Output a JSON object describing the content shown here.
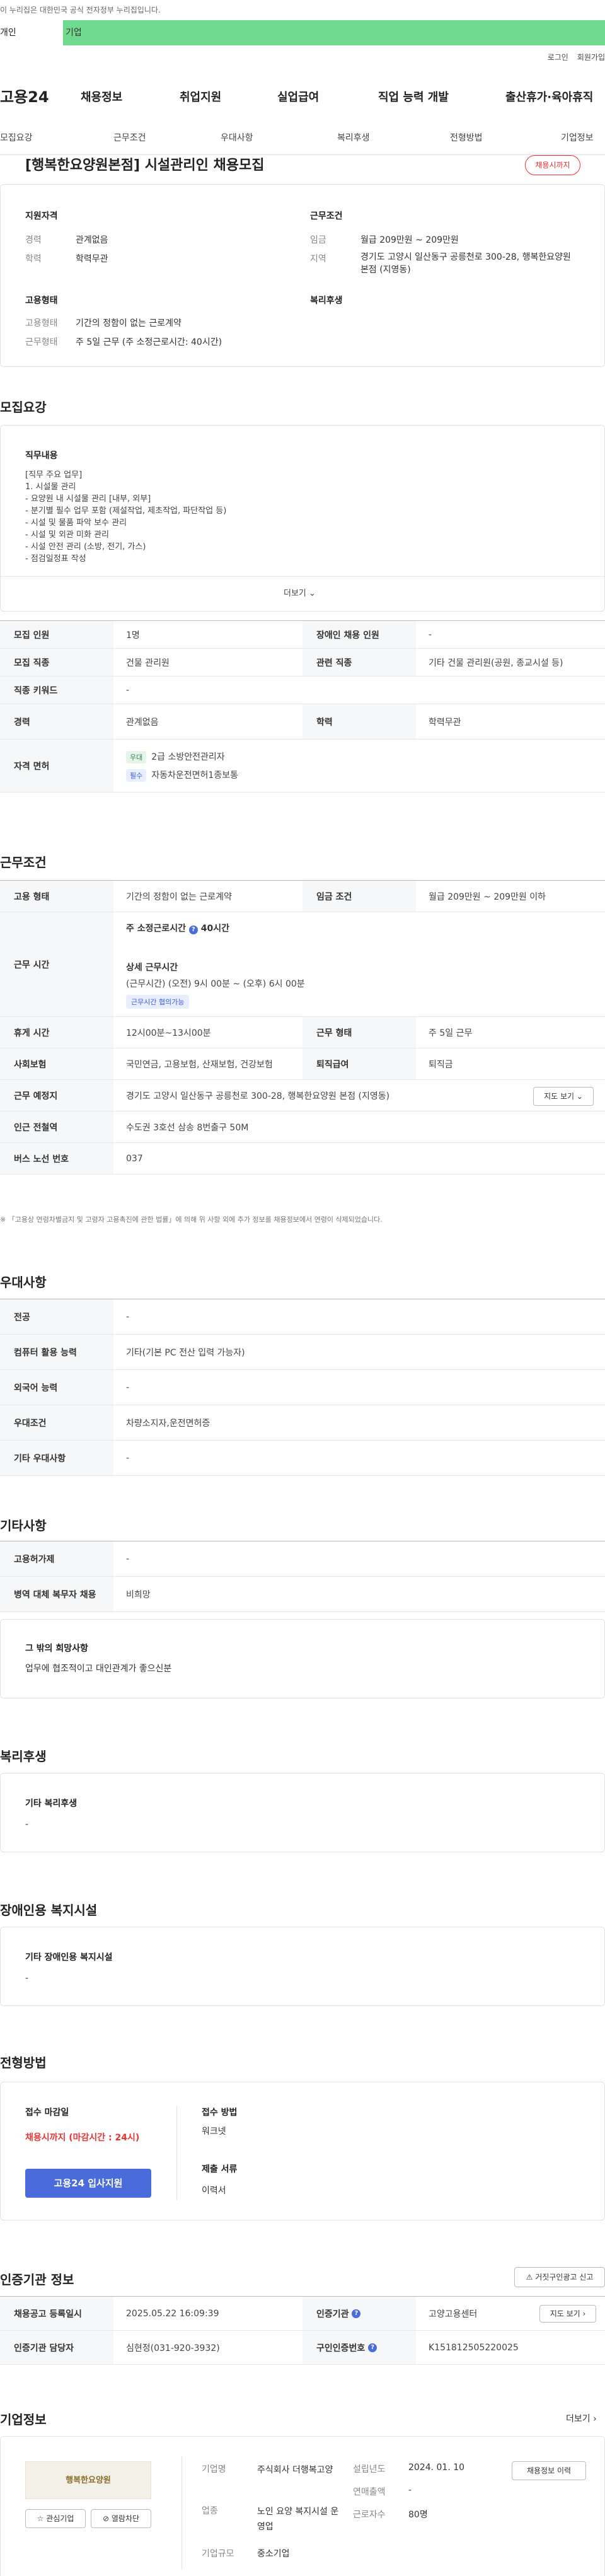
{
  "notice": "이 누리집은 대한민국 공식 전자정부 누리집입니다.",
  "tabs": {
    "personal": "개인",
    "company": "기업"
  },
  "util": {
    "login": "로그인",
    "join": "회원가입"
  },
  "logo": "고용24",
  "gnb": [
    "채용정보",
    "취업지원",
    "실업급여",
    "직업 능력 개발",
    "출산휴가·육아휴직"
  ],
  "lnb": [
    "모집요강",
    "근무조건",
    "우대사항",
    "복리후생",
    "전형방법",
    "기업정보"
  ],
  "job": {
    "title": "[행복한요양원본점] 시설관리인 채용모집",
    "status": "채용시까지"
  },
  "summary": {
    "qual_title": "지원자격",
    "career_label": "경력",
    "career": "관계없음",
    "edu_label": "학력",
    "edu": "학력무관",
    "cond_title": "근무조건",
    "wage_label": "임금",
    "wage": "월급 209만원 ~ 209만원",
    "region_label": "지역",
    "region": "경기도 고양시 일산동구 공릉천로 300-28, 행복한요양원 본점 (지영동)",
    "emp_title": "고용형태",
    "emptype_label": "고용형태",
    "emptype": "기간의 정함이 없는 근로계약",
    "worktype_label": "근무형태",
    "worktype": "주 5일 근무 (주 소정근로시간: 40시간)",
    "welfare_title": "복리후생"
  },
  "recruit": {
    "title": "모집요강",
    "duty_title": "직무내용",
    "duty_lines": [
      "[직무 주요 업무]",
      "1. 시설물 관리",
      "- 요양원 내 시설물 관리 [내부, 외부]",
      "- 분기별 필수 업무 포함 (제설작업, 제초작업, 파단작업 등)",
      "- 시설 및 물품 파악 보수 관리",
      "- 시설 및 외관 미화 관리",
      "- 시설 안전 관리 (소방, 전기, 가스)",
      "- 점검일정표 작성"
    ],
    "more": "더보기",
    "rows": {
      "headcount_k": "모집 인원",
      "headcount": "1명",
      "disabled_k": "장애인 채용 인원",
      "disabled": "-",
      "job_k": "모집 직종",
      "job": "건물 관리원",
      "related_k": "관련 직종",
      "related": "기타 건물 관리원(공원, 종교시설 등)",
      "keyword_k": "직종 키워드",
      "keyword": "-",
      "career_k": "경력",
      "career": "관계없음",
      "edu_k": "학력",
      "edu": "학력무관",
      "license_k": "자격 면허",
      "lic1_tag": "우대",
      "lic1": "2급 소방안전관리자",
      "lic2_tag": "필수",
      "lic2": "자동차운전면허1종보통"
    }
  },
  "condition": {
    "title": "근무조건",
    "emp_k": "고용 형태",
    "emp": "기간의 정함이 없는 근로계약",
    "wage_k": "임금 조건",
    "wage": "월급 209만원 ~ 209만원 이하",
    "hours_k": "근무 시간",
    "hours_main": "주 소정근로시간",
    "hours_main_val": "40시간",
    "detail_title": "상세 근무시간",
    "detail": "(근무시간) (오전) 9시 00분 ~ (오후) 6시 00분",
    "detail_tag": "근무시간 협의가능",
    "rest_k": "휴게 시간",
    "rest": "12시00분~13시00분",
    "form_k": "근무 형태",
    "form": "주 5일 근무",
    "ins_k": "사회보험",
    "ins": "국민연금, 고용보험, 산재보험, 건강보험",
    "sev_k": "퇴직급여",
    "sev": "퇴직금",
    "place_k": "근무 예정지",
    "place": "경기도 고양시 일산동구 공릉천로 300-28, 행복한요양원 본점 (지영동)",
    "map": "지도 보기",
    "station_k": "인근 전철역",
    "station": "수도권 3호선 삼송 8번출구 50M",
    "bus_k": "버스 노선 번호",
    "bus": "037",
    "note": "※ 「고용상 연령차별금지 및 고령자 고용촉진에 관한 법률」에 의해 위 사항 외에 추가 정보를 채용정보에서 연령이 삭제되었습니다."
  },
  "pref": {
    "title": "우대사항",
    "major_k": "전공",
    "major": "-",
    "pc_k": "컴퓨터 활용 능력",
    "pc": "기타(기본 PC 전산 입력 가능자)",
    "lang_k": "외국어 능력",
    "lang": "-",
    "cond_k": "우대조건",
    "cond": "차량소지자,운전면허증",
    "etc_k": "기타 우대사항",
    "etc": "-"
  },
  "other": {
    "title": "기타사항",
    "period_k": "고용허가제",
    "period": "-",
    "mil_k": "병역 대체 복무자 채용",
    "mil": "비희망",
    "wish_title": "그 밖의 희망사항",
    "wish": "업무에 협조적이고 대인관계가 좋으신분"
  },
  "welfare": {
    "title": "복리후생",
    "sub": "기타 복리후생",
    "val": "-"
  },
  "dwelfare": {
    "title": "장애인용 복지시설",
    "sub": "기타 장애인용 복지시설",
    "val": "-"
  },
  "select": {
    "title": "전형방법",
    "deadline_k": "접수 마감일",
    "deadline": "채용시까지 (마감시간 : 24시)",
    "apply": "고용24 입사지원",
    "method_k": "접수 방법",
    "method": "워크넷",
    "docs_k": "제출 서류",
    "docs": "이력서"
  },
  "cert": {
    "title": "인증기관 정보",
    "report": "거짓구인광고 신고",
    "reg_k": "채용공고 등록일시",
    "reg": "2025.05.22 16:09:39",
    "org_k": "인증기관",
    "org": "고양고용센터",
    "map": "지도 보기",
    "mgr_k": "인증기관 담당자",
    "mgr": "심현정(031-920-3932)",
    "no_k": "구인인증번호",
    "no": "K151812505220025"
  },
  "company": {
    "title": "기업정보",
    "more": "더보기",
    "logo_text": "행복한요양원",
    "fav": "관심기업",
    "block": "열람차단",
    "name_k": "기업명",
    "name": "주식회사 더행복고양",
    "biz_k": "업종",
    "biz": "노인 요양 복지시설 운영업",
    "size_k": "기업규모",
    "size": "중소기업",
    "est_k": "설립년도",
    "est": "2024. 01. 10",
    "sales_k": "연매출액",
    "sales": "-",
    "emp_k": "근로자수",
    "emp": "80명",
    "info_btn": "채용정보 이력"
  }
}
